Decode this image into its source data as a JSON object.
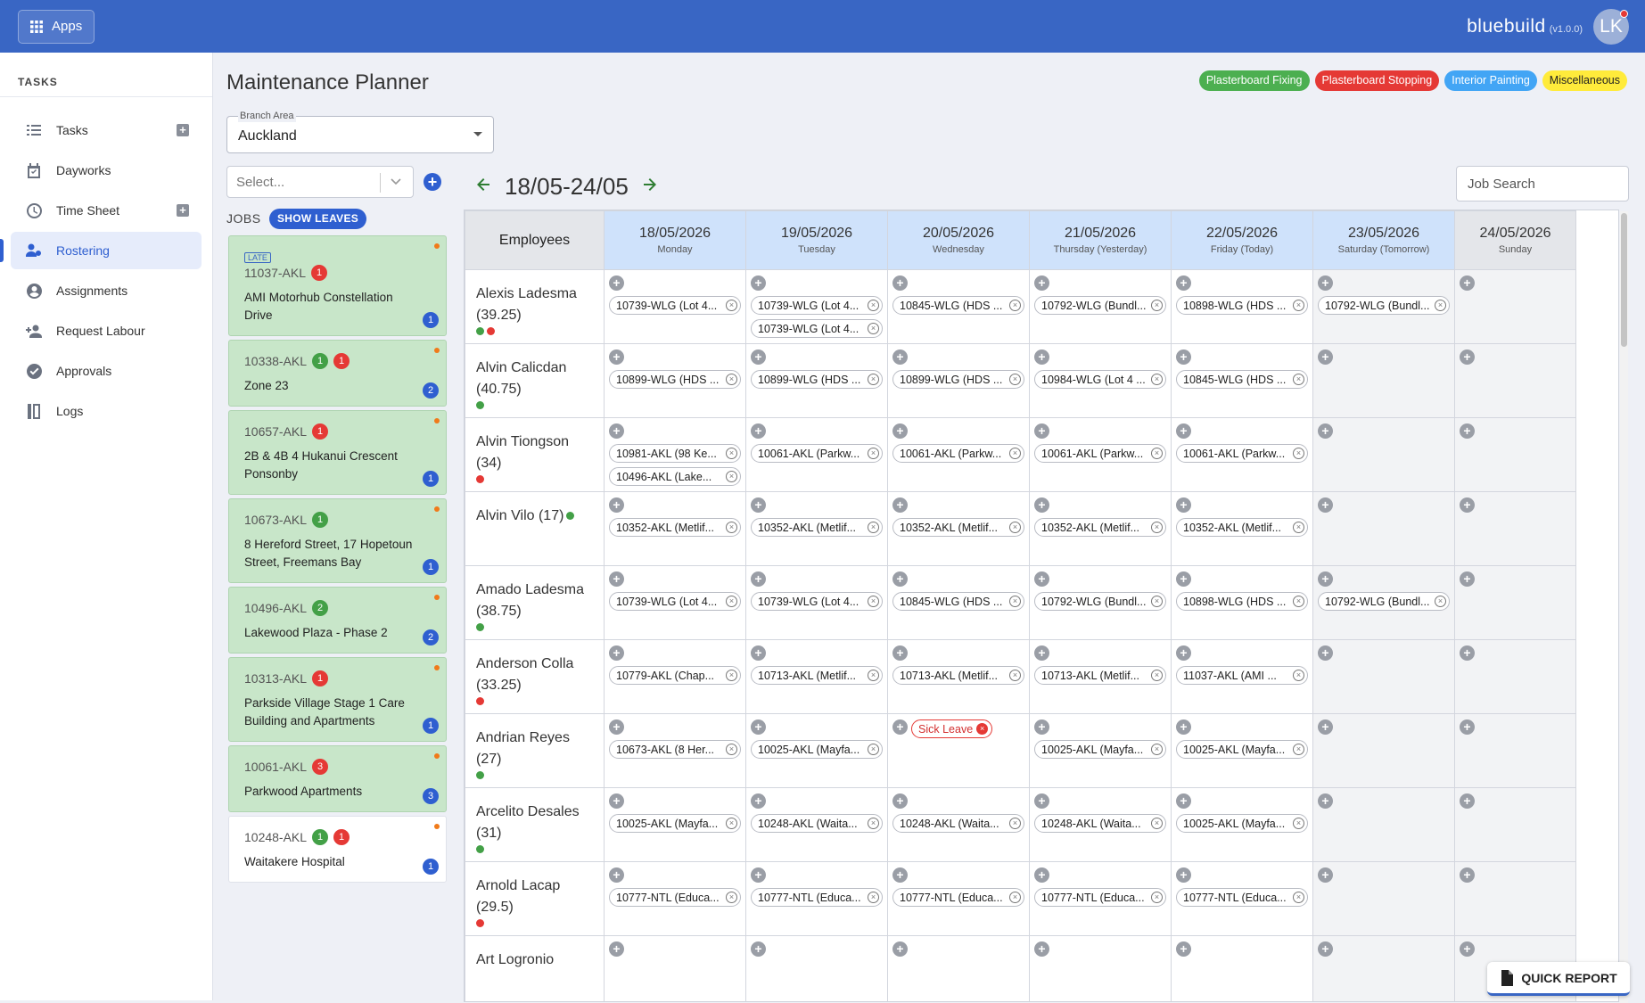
{
  "topbar": {
    "apps_label": "Apps",
    "brand": "bluebuild",
    "version": "(v1.0.0)",
    "avatar_initials": "LK"
  },
  "sidebar": {
    "heading": "TASKS",
    "items": [
      {
        "label": "Tasks",
        "icon": "list-icon",
        "plus": true
      },
      {
        "label": "Dayworks",
        "icon": "calendar-check-icon",
        "plus": false
      },
      {
        "label": "Time Sheet",
        "icon": "clock-icon",
        "plus": true
      },
      {
        "label": "Rostering",
        "icon": "people-gear-icon",
        "plus": false,
        "active": true
      },
      {
        "label": "Assignments",
        "icon": "account-circle-icon",
        "plus": false
      },
      {
        "label": "Request Labour",
        "icon": "person-add-icon",
        "plus": false
      },
      {
        "label": "Approvals",
        "icon": "check-circle-icon",
        "plus": false
      },
      {
        "label": "Logs",
        "icon": "book-icon",
        "plus": false
      }
    ]
  },
  "page": {
    "title": "Maintenance Planner"
  },
  "legend": [
    {
      "label": "Plasterboard Fixing",
      "color": "#4caf50"
    },
    {
      "label": "Plasterboard Stopping",
      "color": "#e53935"
    },
    {
      "label": "Interior Painting",
      "color": "#42a5f5"
    },
    {
      "label": "Miscellaneous",
      "color": "#ffeb3b"
    }
  ],
  "filters": {
    "branch_label": "Branch Area",
    "branch_value": "Auckland",
    "select_placeholder": "Select...",
    "jobs_label": "JOBS",
    "show_leaves": "SHOW LEAVES",
    "job_search": "Job Search"
  },
  "week": {
    "label": "18/05-24/05"
  },
  "jobs": [
    {
      "late": "LATE",
      "code": "11037-AKL",
      "green": "",
      "red": "1",
      "name": "AMI Motorhub Constellation Drive",
      "count": "1",
      "white": false
    },
    {
      "late": "",
      "code": "10338-AKL",
      "green": "1",
      "red": "1",
      "name": "Zone 23",
      "count": "2",
      "white": false
    },
    {
      "late": "",
      "code": "10657-AKL",
      "green": "",
      "red": "1",
      "name": "2B & 4B 4 Hukanui Crescent Ponsonby",
      "count": "1",
      "white": false
    },
    {
      "late": "",
      "code": "10673-AKL",
      "green": "1",
      "red": "",
      "name": "8 Hereford Street, 17 Hopetoun Street, Freemans Bay",
      "count": "1",
      "white": false
    },
    {
      "late": "",
      "code": "10496-AKL",
      "green": "2",
      "red": "",
      "name": "Lakewood Plaza - Phase 2",
      "count": "2",
      "white": false
    },
    {
      "late": "",
      "code": "10313-AKL",
      "green": "",
      "red": "1",
      "name": "Parkside Village Stage 1 Care Building and Apartments",
      "count": "1",
      "white": false
    },
    {
      "late": "",
      "code": "10061-AKL",
      "green": "",
      "red": "3",
      "name": "Parkwood Apartments",
      "count": "3",
      "white": false
    },
    {
      "late": "",
      "code": "10248-AKL",
      "green": "1",
      "red": "1",
      "name": "Waitakere Hospital",
      "count": "1",
      "white": true
    }
  ],
  "grid": {
    "employees_header": "Employees",
    "days": [
      {
        "date": "18/05/2026",
        "weekday": "Monday"
      },
      {
        "date": "19/05/2026",
        "weekday": "Tuesday"
      },
      {
        "date": "20/05/2026",
        "weekday": "Wednesday"
      },
      {
        "date": "21/05/2026",
        "weekday": "Thursday (Yesterday)"
      },
      {
        "date": "22/05/2026",
        "weekday": "Friday (Today)"
      },
      {
        "date": "23/05/2026",
        "weekday": "Saturday (Tomorrow)"
      },
      {
        "date": "24/05/2026",
        "weekday": "Sunday"
      }
    ],
    "rows": [
      {
        "name": "Alexis Ladesma (39.25)",
        "dots": [
          "#43a047",
          "#e53935"
        ],
        "cells": [
          [
            "10739-WLG (Lot 4..."
          ],
          [
            "10739-WLG (Lot 4...",
            "10739-WLG (Lot 4..."
          ],
          [
            "10845-WLG (HDS ..."
          ],
          [
            "10792-WLG (Bundl..."
          ],
          [
            "10898-WLG (HDS ..."
          ],
          [
            "10792-WLG (Bundl..."
          ],
          []
        ]
      },
      {
        "name": "Alvin Calicdan (40.75)",
        "dots": [
          "#43a047"
        ],
        "cells": [
          [
            "10899-WLG (HDS ..."
          ],
          [
            "10899-WLG (HDS ..."
          ],
          [
            "10899-WLG (HDS ..."
          ],
          [
            "10984-WLG (Lot 4 ..."
          ],
          [
            "10845-WLG (HDS ..."
          ],
          [],
          []
        ]
      },
      {
        "name": "Alvin Tiongson (34)",
        "dots": [
          "#e53935"
        ],
        "cells": [
          [
            "10981-AKL (98 Ke...",
            "10496-AKL (Lake..."
          ],
          [
            "10061-AKL (Parkw..."
          ],
          [
            "10061-AKL (Parkw..."
          ],
          [
            "10061-AKL (Parkw..."
          ],
          [
            "10061-AKL (Parkw..."
          ],
          [],
          []
        ]
      },
      {
        "name": "Alvin Vilo (17)",
        "inline_dot": "#43a047",
        "dots": [],
        "cells": [
          [
            "10352-AKL (Metlif..."
          ],
          [
            "10352-AKL (Metlif..."
          ],
          [
            "10352-AKL (Metlif..."
          ],
          [
            "10352-AKL (Metlif..."
          ],
          [
            "10352-AKL (Metlif..."
          ],
          [],
          []
        ]
      },
      {
        "name": "Amado Ladesma (38.75)",
        "dots": [
          "#43a047"
        ],
        "cells": [
          [
            "10739-WLG (Lot 4..."
          ],
          [
            "10739-WLG (Lot 4..."
          ],
          [
            "10845-WLG (HDS ..."
          ],
          [
            "10792-WLG (Bundl..."
          ],
          [
            "10898-WLG (HDS ..."
          ],
          [
            "10792-WLG (Bundl..."
          ],
          []
        ]
      },
      {
        "name": "Anderson Colla (33.25)",
        "dots": [
          "#e53935"
        ],
        "cells": [
          [
            "10779-AKL (Chap..."
          ],
          [
            "10713-AKL (Metlif..."
          ],
          [
            "10713-AKL (Metlif..."
          ],
          [
            "10713-AKL (Metlif..."
          ],
          [
            "11037-AKL (AMI ..."
          ],
          [],
          []
        ]
      },
      {
        "name": "Andrian Reyes (27)",
        "dots": [
          "#43a047"
        ],
        "cells": [
          [
            "10673-AKL (8 Her..."
          ],
          [
            "10025-AKL (Mayfa..."
          ],
          [
            "SICK:Sick Leave"
          ],
          [
            "10025-AKL (Mayfa..."
          ],
          [
            "10025-AKL (Mayfa..."
          ],
          [],
          []
        ]
      },
      {
        "name": "Arcelito Desales (31)",
        "dots": [
          "#43a047"
        ],
        "cells": [
          [
            "10025-AKL (Mayfa..."
          ],
          [
            "10248-AKL (Waita..."
          ],
          [
            "10248-AKL (Waita..."
          ],
          [
            "10248-AKL (Waita..."
          ],
          [
            "10025-AKL (Mayfa..."
          ],
          [],
          []
        ]
      },
      {
        "name": "Arnold Lacap (29.5)",
        "dots": [
          "#e53935"
        ],
        "cells": [
          [
            "10777-NTL (Educa..."
          ],
          [
            "10777-NTL (Educa..."
          ],
          [
            "10777-NTL (Educa..."
          ],
          [
            "10777-NTL (Educa..."
          ],
          [
            "10777-NTL (Educa..."
          ],
          [],
          []
        ]
      },
      {
        "name": "Art Logronio",
        "dots": [],
        "cells": [
          [],
          [],
          [],
          [],
          [],
          [],
          []
        ]
      }
    ]
  },
  "quick_report": "QUICK REPORT"
}
